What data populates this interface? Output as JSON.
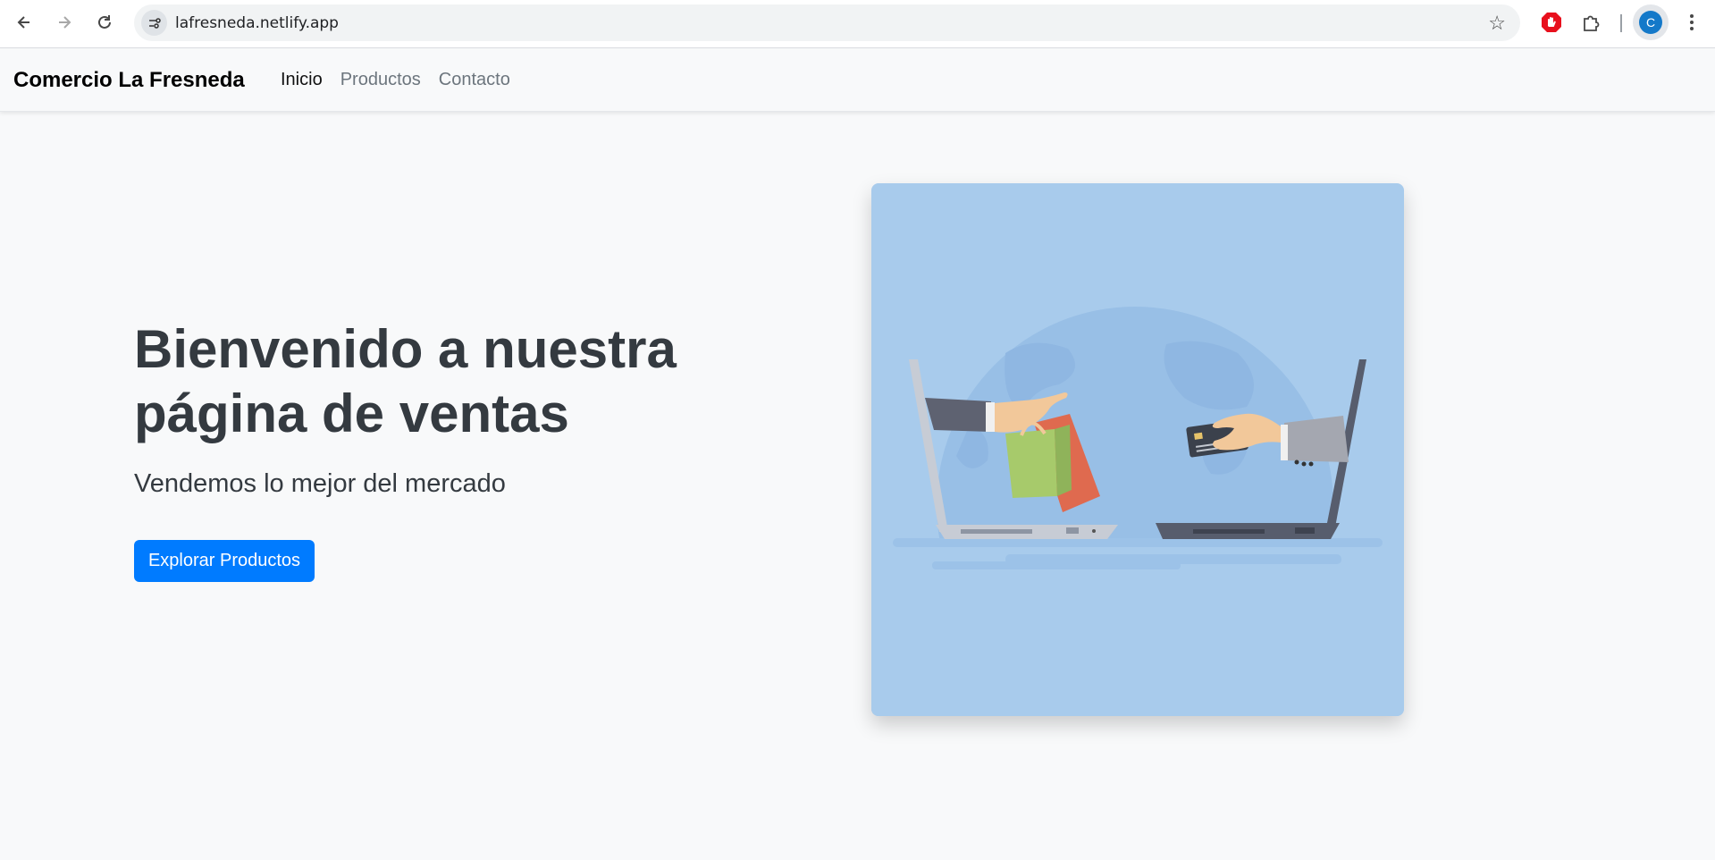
{
  "browser": {
    "url": "lafresneda.netlify.app",
    "profile_initial": "C",
    "icons": [
      "back-arrow-icon",
      "forward-arrow-icon",
      "reload-icon",
      "site-info-icon",
      "bookmark-star-icon",
      "adblock-extension-icon",
      "extensions-puzzle-icon",
      "kebab-menu-icon"
    ]
  },
  "navbar": {
    "brand": "Comercio La Fresneda",
    "links": [
      {
        "label": "Inicio",
        "active": true
      },
      {
        "label": "Productos",
        "active": false
      },
      {
        "label": "Contacto",
        "active": false
      }
    ]
  },
  "hero": {
    "title": "Bienvenido a nuestra página de ventas",
    "subtitle": "Vendemos lo mejor del mercado",
    "cta_label": "Explorar Productos",
    "image_alt": "ecommerce-illustration"
  },
  "colors": {
    "primary": "#007bff",
    "background": "#f8f9fa",
    "text": "#343a40",
    "image_bg": "#a8cbec"
  }
}
